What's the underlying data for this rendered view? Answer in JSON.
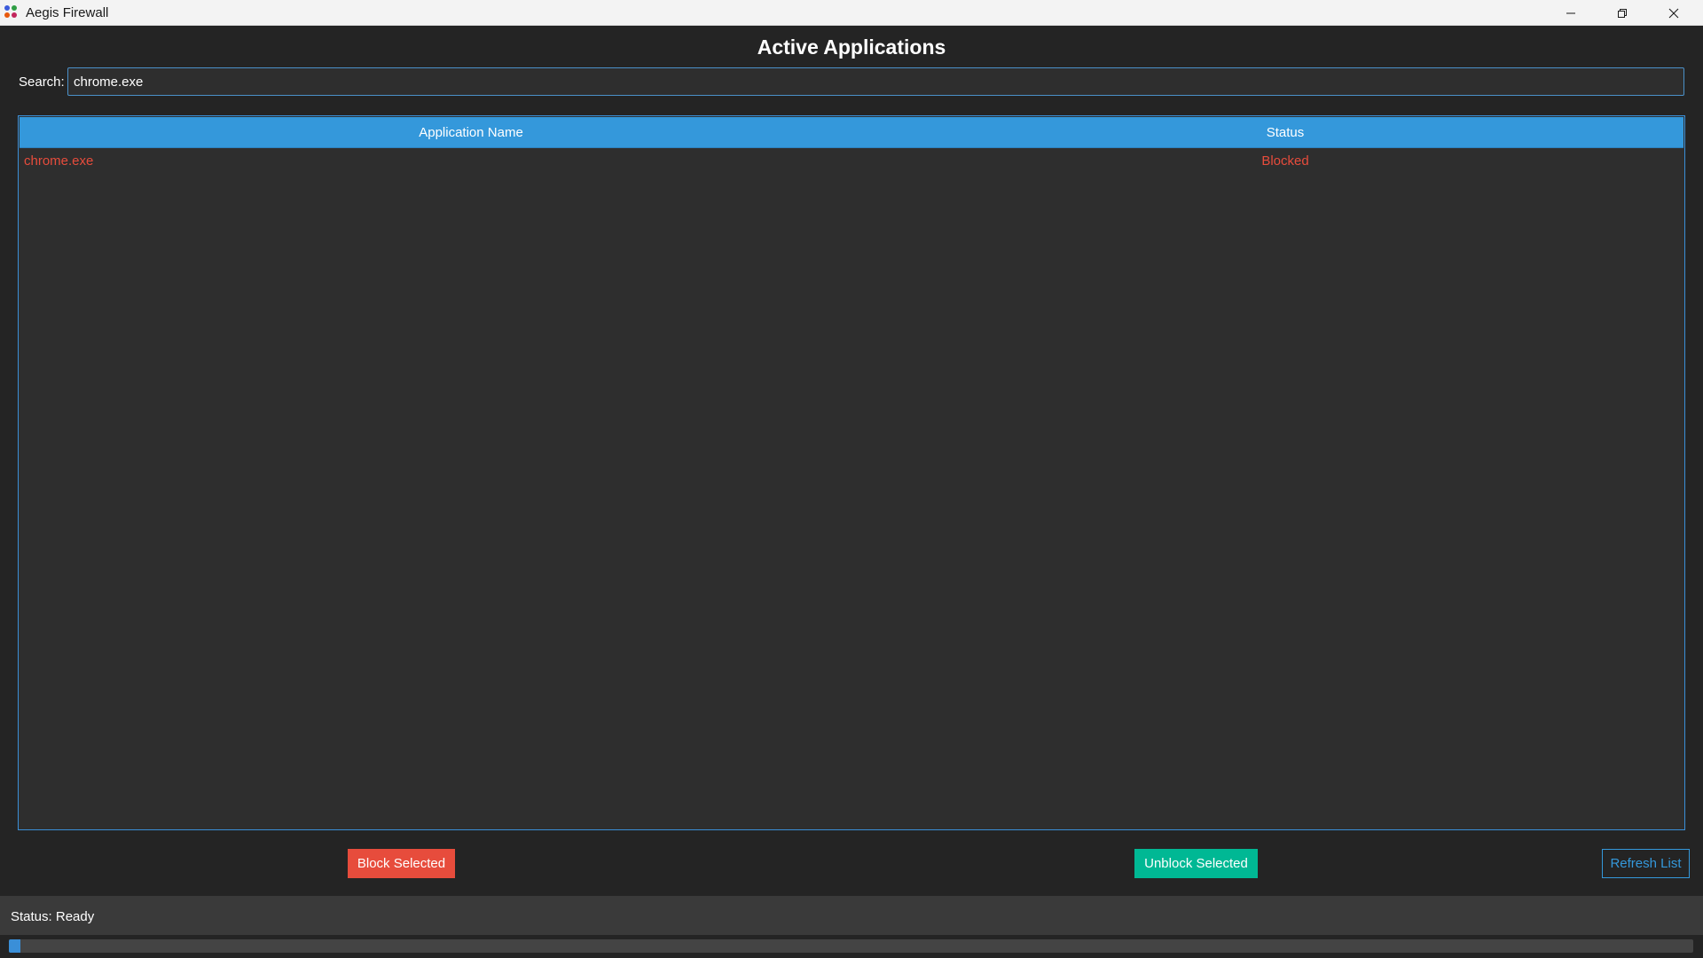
{
  "window": {
    "title": "Aegis Firewall",
    "controls": {
      "minimize": "minimize-icon",
      "maximize": "restore-icon",
      "close": "close-icon"
    }
  },
  "heading": "Active Applications",
  "search": {
    "label": "Search:",
    "value": "chrome.exe",
    "placeholder": ""
  },
  "table": {
    "columns": [
      "Application Name",
      "Status"
    ],
    "rows": [
      {
        "name": "chrome.exe",
        "status": "Blocked"
      }
    ]
  },
  "buttons": {
    "block": "Block Selected",
    "unblock": "Unblock Selected",
    "refresh": "Refresh List"
  },
  "status": {
    "text": "Status: Ready"
  },
  "progress": {
    "value": 0.007
  },
  "colors": {
    "accent": "#3498db",
    "blocked": "#e74c3c",
    "unblock": "#00b894"
  }
}
